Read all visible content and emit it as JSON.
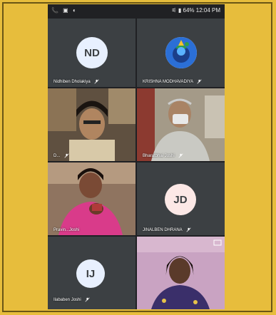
{
  "status_bar": {
    "left_icons": "📞 ▣ ◐",
    "right_text": "⚟ ▮ 64% 12:04 PM"
  },
  "colors": {
    "page_bg": "#e7bd3c",
    "phone_bg": "#202124",
    "tile_bg": "#3c4043",
    "avatar_nd": "#e8f0fe",
    "avatar_jd": "#fce8e6",
    "avatar_ij": "#e8f0fe",
    "avatar_text": "#3c4043"
  },
  "tiles": [
    {
      "id": "nd",
      "initials": "ND",
      "name": "Nidhiben Dholakiya",
      "muted": true
    },
    {
      "id": "km",
      "initials": "",
      "name": "KRISHNA MODHAVADIYA",
      "muted": true
    },
    {
      "id": "p1",
      "initials": "",
      "name": "D...",
      "muted": true
    },
    {
      "id": "p2",
      "initials": "",
      "name": "Bharatbhai Joshi",
      "muted": true
    },
    {
      "id": "p3",
      "initials": "",
      "name": "Pravin...Joshi",
      "muted": false
    },
    {
      "id": "jd",
      "initials": "JD",
      "name": "JINALBEN DHRANA",
      "muted": true
    },
    {
      "id": "ij",
      "initials": "IJ",
      "name": "Ilababen Joshi",
      "muted": true
    },
    {
      "id": "p4",
      "initials": "",
      "name": "",
      "muted": false
    }
  ]
}
